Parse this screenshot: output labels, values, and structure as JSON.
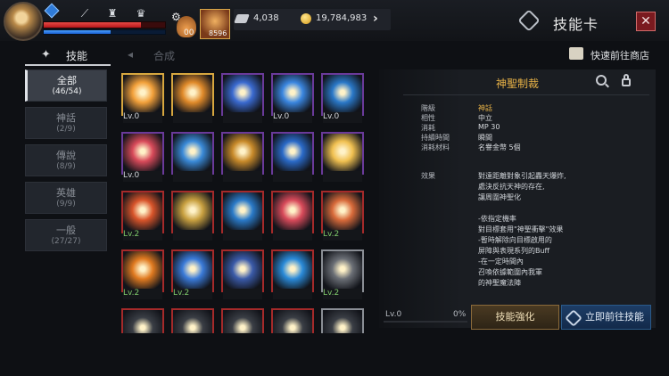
{
  "header": {
    "hp_fraction": 0.8,
    "mp_fraction": 0.55,
    "potion_count": "00",
    "slot_count": "8596",
    "currency_wing": "4,038",
    "currency_gold": "19,784,983",
    "title": "技能卡"
  },
  "tabs": {
    "skill": "技能",
    "compose": "合成"
  },
  "shop_link": "快速前往商店",
  "categories": [
    {
      "name": "全部",
      "count": "(46/54)",
      "active": true
    },
    {
      "name": "神話",
      "count": "(2/9)",
      "active": false
    },
    {
      "name": "傳說",
      "count": "(8/9)",
      "active": false
    },
    {
      "name": "英雄",
      "count": "(9/9)",
      "active": false
    },
    {
      "name": "一般",
      "count": "(27/27)",
      "active": false
    }
  ],
  "skills": [
    {
      "icon": "radiant-burst-icon",
      "border": "gold",
      "level": "Lv.0",
      "level_color": "white",
      "color": "#f2a03a"
    },
    {
      "icon": "praying-saint-icon",
      "border": "gold",
      "level": "",
      "level_color": "white",
      "color": "#e08a2a"
    },
    {
      "icon": "hexagram-seal-icon",
      "border": "purple",
      "level": "",
      "level_color": "white",
      "color": "#3a6ad0"
    },
    {
      "icon": "star-emblem-icon",
      "border": "purple",
      "level": "Lv.0",
      "level_color": "white",
      "color": "#3a86e0"
    },
    {
      "icon": "holy-cross-shield-icon",
      "border": "purple",
      "level": "Lv.0",
      "level_color": "white",
      "color": "#2a78c8"
    },
    {
      "icon": "holy-book-icon",
      "border": "purple",
      "level": "Lv.0",
      "level_color": "white",
      "color": "#d84a5a"
    },
    {
      "icon": "light-blade-icon",
      "border": "purple",
      "level": "",
      "level_color": "white",
      "color": "#3a8ad8"
    },
    {
      "icon": "gold-shield-icon",
      "border": "purple",
      "level": "",
      "level_color": "white",
      "color": "#c88a2a"
    },
    {
      "icon": "blue-bible-icon",
      "border": "purple",
      "level": "",
      "level_color": "white",
      "color": "#2a6ac8"
    },
    {
      "icon": "winged-angel-icon",
      "border": "purple",
      "level": "",
      "level_color": "white",
      "color": "#f0c050"
    },
    {
      "icon": "cross-rune-icon",
      "border": "red",
      "level": "Lv.2",
      "level_color": "green",
      "color": "#d8542a"
    },
    {
      "icon": "praying-hands-icon",
      "border": "red",
      "level": "",
      "level_color": "white",
      "color": "#c8a040"
    },
    {
      "icon": "blue-shield-icon",
      "border": "red",
      "level": "",
      "level_color": "white",
      "color": "#2a7ac8"
    },
    {
      "icon": "red-tome-icon",
      "border": "red",
      "level": "",
      "level_color": "white",
      "color": "#d84a5a"
    },
    {
      "icon": "cross-tome-icon",
      "border": "red",
      "level": "Lv.2",
      "level_color": "green",
      "color": "#d86a3a"
    },
    {
      "icon": "spin-swirl-icon",
      "border": "red",
      "level": "Lv.2",
      "level_color": "green",
      "color": "#e07a20"
    },
    {
      "icon": "sword-strike-icon",
      "border": "red",
      "level": "Lv.2",
      "level_color": "green",
      "color": "#3a7ad8"
    },
    {
      "icon": "exp-badge-icon",
      "border": "red",
      "level": "",
      "level_color": "white",
      "color": "#3a5aa8"
    },
    {
      "icon": "blue-boot-icon",
      "border": "red",
      "level": "",
      "level_color": "white",
      "color": "#2a8ad8"
    },
    {
      "icon": "silver-shield-icon",
      "border": "gray",
      "level": "Lv.2",
      "level_color": "green",
      "color": "#6a6e75"
    },
    {
      "icon": "lightning-icon",
      "border": "red",
      "level": "",
      "level_color": "white",
      "color": "#3a3e45"
    },
    {
      "icon": "cycle-arrow-icon",
      "border": "red",
      "level": "",
      "level_color": "white",
      "color": "#3a3e45"
    },
    {
      "icon": "burst-star-icon",
      "border": "red",
      "level": "",
      "level_color": "white",
      "color": "#3a3e45"
    },
    {
      "icon": "shield-arrow-icon",
      "border": "red",
      "level": "",
      "level_color": "white",
      "color": "#3a3e45"
    },
    {
      "icon": "feather-icon",
      "border": "gray",
      "level": "",
      "level_color": "white",
      "color": "#3a3e45"
    }
  ],
  "detail": {
    "name": "神聖制裁",
    "stats": [
      {
        "label": "階級",
        "value": "神話",
        "grade": true
      },
      {
        "label": "相性",
        "value": "中立",
        "grade": false
      },
      {
        "label": "消耗",
        "value": "MP 30",
        "grade": false
      },
      {
        "label": "持續時間",
        "value": "瞬間",
        "grade": false
      },
      {
        "label": "消耗材料",
        "value": "名譽金幣 5個",
        "grade": false
      }
    ],
    "effect_label": "效果",
    "effect_lines": [
      "對遠距離對象引起轟天爆炸,",
      "處決反抗天神的存在,",
      "讓周圍神聖化",
      "",
      "-依指定機率",
      "對目標套用\"神聖衝擊\"效果",
      "-暫時解除向目標啟用的",
      "屏障與表現系列的Buff",
      "-在一定時間內",
      "召喚依據範圍內我軍",
      "的神聖魔法陣"
    ],
    "level_label": "Lv.0",
    "percent_label": "0%",
    "enhance_button": "技能強化",
    "goto_button": "立即前往技能"
  }
}
